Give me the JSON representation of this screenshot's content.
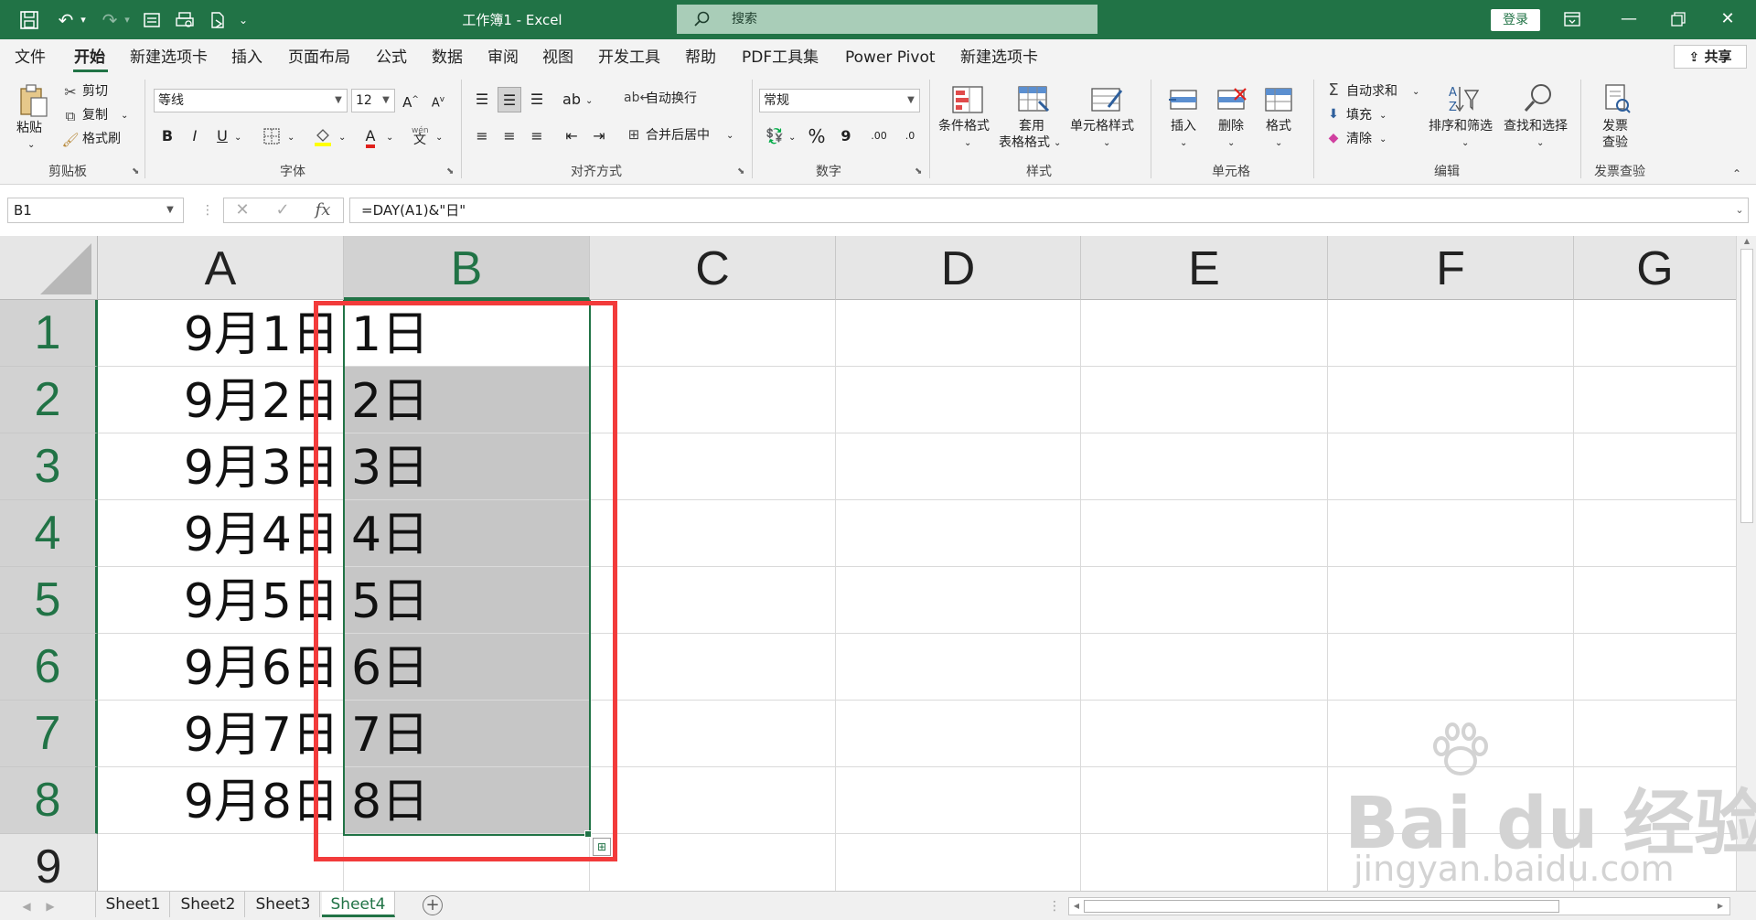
{
  "titlebar": {
    "title": "工作簿1  -  Excel",
    "search_text": "搜索",
    "login": "登录",
    "icons": [
      "save-icon",
      "undo-icon",
      "redo-icon",
      "form-icon",
      "print-preview-icon",
      "export-icon",
      "customize-icon"
    ]
  },
  "menu": {
    "tabs": [
      "文件",
      "开始",
      "新建选项卡",
      "插入",
      "页面布局",
      "公式",
      "数据",
      "审阅",
      "视图",
      "开发工具",
      "帮助",
      "PDF工具集",
      "Power Pivot",
      "新建选项卡"
    ],
    "active": "开始",
    "share": "共享"
  },
  "ribbon": {
    "clipboard": {
      "paste": "粘贴",
      "cut": "剪切",
      "copy": "复制",
      "format_painter": "格式刷",
      "label": "剪贴板"
    },
    "font": {
      "name": "等线",
      "size": "12",
      "label": "字体",
      "bold": "B",
      "italic": "I",
      "underline": "U",
      "wen": "wén"
    },
    "alignment": {
      "wrap": "自动换行",
      "merge": "合并后居中",
      "label": "对齐方式"
    },
    "number": {
      "format": "常规",
      "percent": "%",
      "comma": "9",
      "label": "数字",
      "dec_inc": ".00",
      "dec_dec": ".0"
    },
    "styles": {
      "conditional": "条件格式",
      "table_1": "套用",
      "table_2": "表格格式",
      "cell_styles": "单元格样式",
      "label": "样式"
    },
    "cells": {
      "insert": "插入",
      "delete": "删除",
      "format": "格式",
      "label": "单元格"
    },
    "editing": {
      "autosum": "自动求和",
      "fill": "填充",
      "clear": "清除",
      "sort": "排序和筛选",
      "find": "查找和选择",
      "label": "编辑"
    },
    "invoice": {
      "line1": "发票",
      "line2": "查验",
      "label": "发票查验"
    }
  },
  "formula_bar": {
    "name_box": "B1",
    "formula": "=DAY(A1)&\"日\"",
    "fx": "fx"
  },
  "grid": {
    "columns": [
      "A",
      "B",
      "C",
      "D",
      "E",
      "F",
      "G"
    ],
    "selected_column": "B",
    "rows": [
      "1",
      "2",
      "3",
      "4",
      "5",
      "6",
      "7",
      "8",
      "9"
    ],
    "col_a": [
      "9月1日",
      "9月2日",
      "9月3日",
      "9月4日",
      "9月5日",
      "9月6日",
      "9月7日",
      "9月8日"
    ],
    "col_b": [
      "1日",
      "2日",
      "3日",
      "4日",
      "5日",
      "6日",
      "7日",
      "8日"
    ]
  },
  "sheets": {
    "tabs": [
      "Sheet1",
      "Sheet2",
      "Sheet3",
      "Sheet4"
    ],
    "active": "Sheet4"
  },
  "watermark": {
    "logo": "Bai du 经验",
    "url": "jingyan.baidu.com"
  },
  "colors": {
    "accent": "#217346",
    "highlight_box": "#f23b3b",
    "selection_fill": "#c6c6c6"
  }
}
